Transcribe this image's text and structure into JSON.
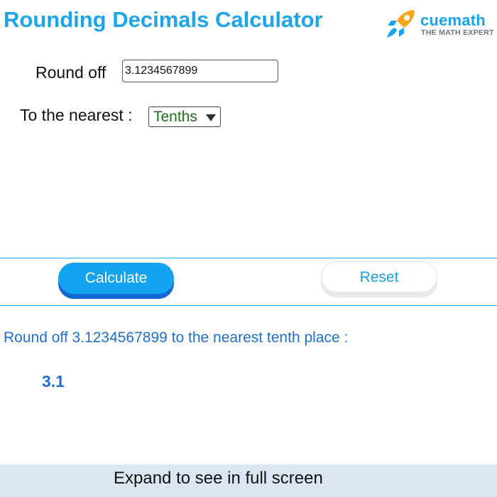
{
  "header": {
    "title": "Rounding Decimals Calculator",
    "brand_colors": {
      "title": "#1ca4ec",
      "logo_orange": "#f7a51c",
      "logo_blue": "#17a6ee"
    }
  },
  "logo": {
    "name": "cuemath",
    "tagline": "THE MATH EXPERT",
    "icon": "rocket-icon"
  },
  "form": {
    "round_label": "Round off",
    "input_value": "3.1234567899",
    "nearest_label": "To the nearest :",
    "nearest_selected": "Tenths",
    "dropdown_icon": "caret-down-icon"
  },
  "actions": {
    "calculate_label": "Calculate",
    "reset_label": "Reset",
    "calculate_color": "#14a3f0"
  },
  "result": {
    "text": "Round off 3.1234567899 to the nearest tenth place :",
    "value": "3.1",
    "color": "#1f6fd1"
  },
  "footer": {
    "label": "Expand to see in full screen"
  }
}
